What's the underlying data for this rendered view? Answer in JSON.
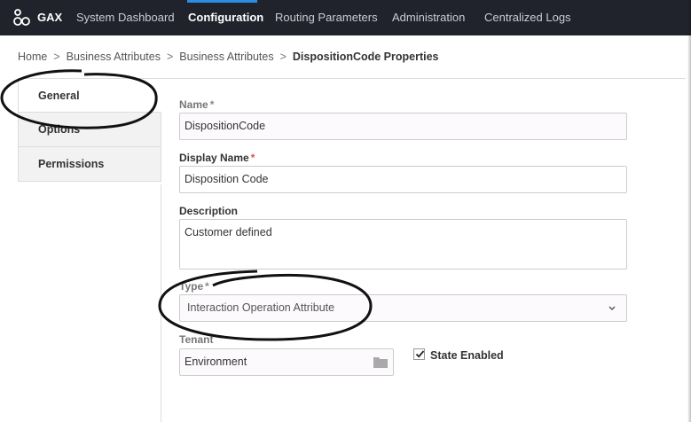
{
  "header": {
    "brand": "GAX",
    "nav": [
      {
        "label": "System Dashboard"
      },
      {
        "label": "Configuration"
      },
      {
        "label": "Routing Parameters"
      },
      {
        "label": "Administration"
      },
      {
        "label": "Centralized Logs"
      }
    ],
    "active_nav": "Configuration"
  },
  "breadcrumb": {
    "items": [
      "Home",
      "Business Attributes",
      "Business Attributes"
    ],
    "separator": ">",
    "current": "DispositionCode Properties"
  },
  "tabs": [
    {
      "label": "General",
      "active": true
    },
    {
      "label": "Options",
      "active": false
    },
    {
      "label": "Permissions",
      "active": false
    }
  ],
  "form": {
    "name": {
      "label": "Name",
      "required_mark": "*",
      "value": "DispositionCode"
    },
    "display_name": {
      "label": "Display Name",
      "required_mark": "*",
      "value": "Disposition Code"
    },
    "description": {
      "label": "Description",
      "value": "Customer defined"
    },
    "type": {
      "label": "Type",
      "required_mark": "*",
      "value": "Interaction Operation Attribute"
    },
    "tenant": {
      "label": "Tenant",
      "value": "Environment"
    },
    "state_enabled": {
      "label": "State Enabled",
      "checked": true
    }
  },
  "colors": {
    "topbar": "#20232b",
    "accent": "#2c8de6",
    "required": "#d9534f"
  },
  "icons": {
    "logo": "gax-logo-icon",
    "dropdown": "chevron-down-icon",
    "browse": "folder-icon",
    "check": "checkmark-icon"
  }
}
